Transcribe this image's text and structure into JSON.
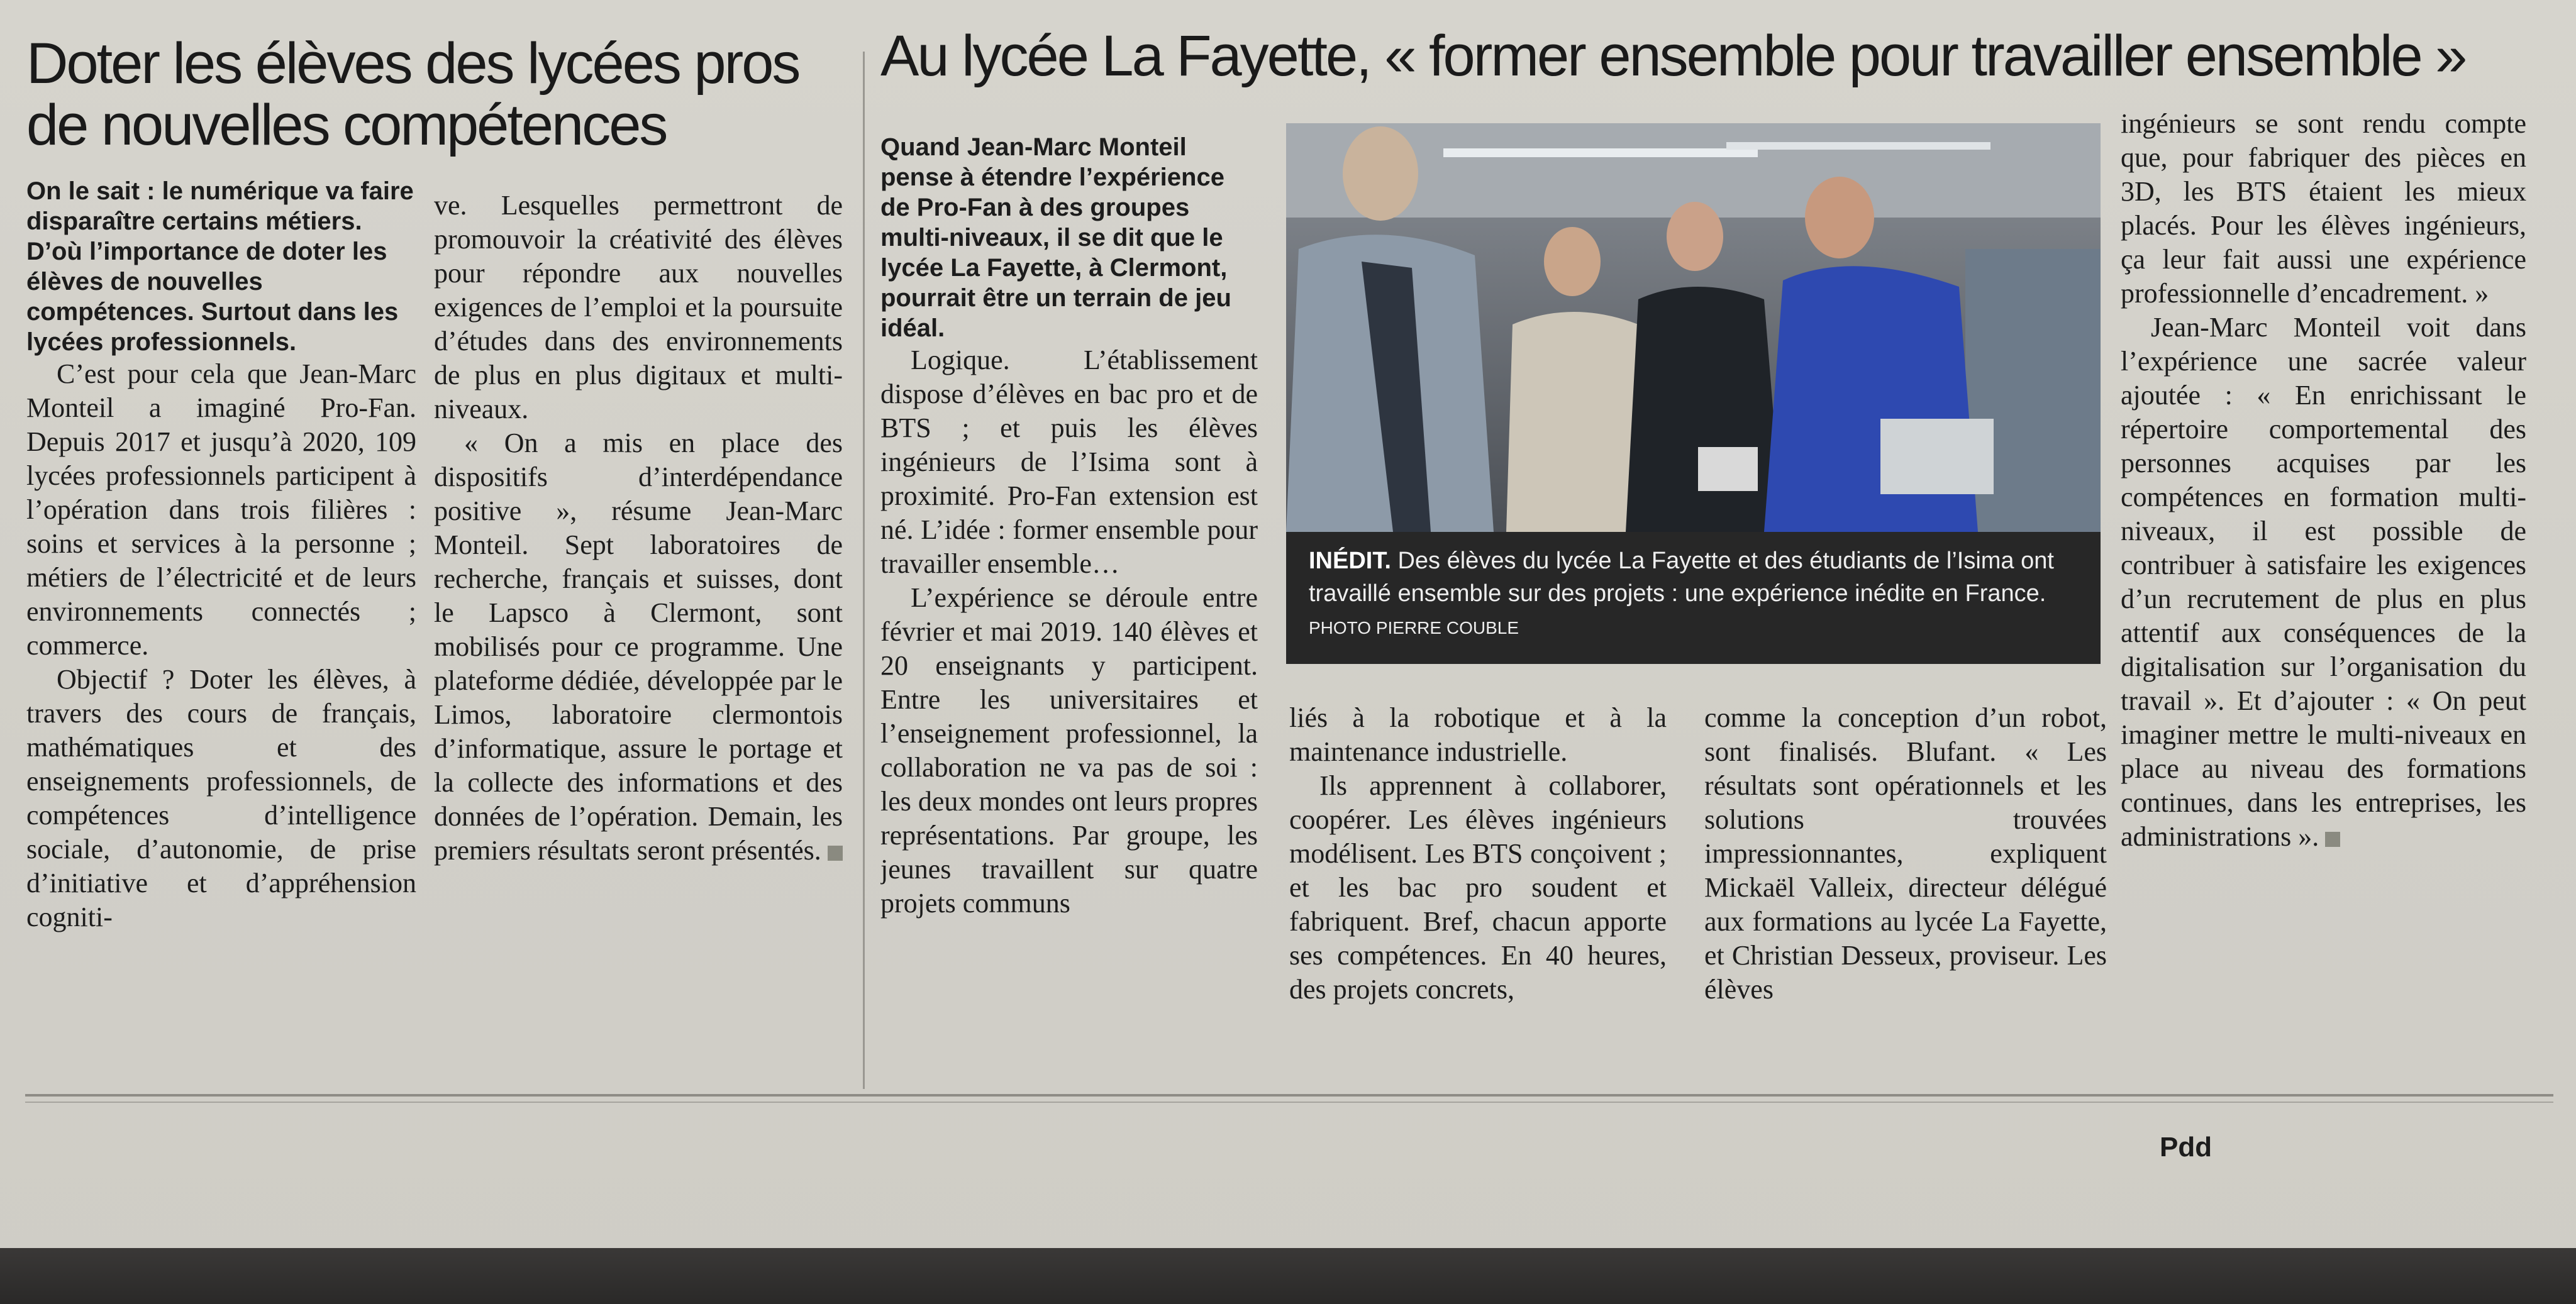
{
  "left_article": {
    "title_line1": "Doter les élèves des lycées pros",
    "title_line2": "de nouvelles compétences",
    "lead": "On le sait : le numérique va faire disparaître certains métiers. D’où l’importance de doter les élèves de nouvelles compétences. Surtout dans les lycées professionnels.",
    "col1_p1": "C’est pour cela que Jean-Marc Monteil a imaginé Pro-Fan. Depuis 2017 et jusqu’à 2020, 109 lycées professionnels participent à l’opération dans trois filières : soins et services à la personne ; métiers de l’électricité et de leurs environnements connectés ; commerce.",
    "col1_p2": "Objectif ? Doter les élèves, à travers des cours de français, mathématiques et des enseignements professionnels, de compétences d’intelligence sociale, d’autonomie, de prise d’initiative et d’appréhension cogniti-",
    "col2_p1": "ve. Lesquelles permettront de promouvoir la créativité des élèves pour répondre aux nouvelles exigences de l’emploi et la poursuite d’études dans des environnements de plus en plus digitaux et multi-niveaux.",
    "col2_p2": "« On a mis en place des dispositifs d’interdépendance positive », résume Jean-Marc Monteil. Sept laboratoires de recherche, français et suisses, dont le Lapsco à Clermont, sont mobilisés pour ce programme. Une plateforme dédiée, développée par le Limos, laboratoire clermontois d’informatique, assure le portage et la collecte des informations et des données de l’opération. Demain, les premiers résultats seront présentés."
  },
  "right_article": {
    "title": "Au lycée La Fayette, « former ensemble pour travailler ensemble »",
    "lead": "Quand Jean-Marc Monteil pense à étendre l’expérience de Pro-Fan à des groupes multi-niveaux, il se dit que le lycée La Fayette, à Clermont, pourrait être un terrain de jeu idéal.",
    "col3_p1": "Logique. L’établissement dispose d’élèves en bac pro et de BTS ; et puis les élèves ingénieurs de l’Isima sont à proximité. Pro-Fan extension est né. L’idée : former ensemble pour travailler ensemble…",
    "col3_p2": "L’expérience se déroule entre février et mai 2019. 140 élèves et 20 enseignants y participent. Entre les universitaires et l’enseignement professionnel, la collaboration ne va pas de soi : les deux mondes ont leurs propres représentations. Par groupe, les jeunes travaillent sur quatre projets communs",
    "col4_p1": "liés à la robotique et à la maintenance industrielle.",
    "col4_p2": "Ils apprennent à collaborer, coopérer. Les élèves ingénieurs modélisent. Les BTS conçoivent ; et les bac pro soudent et fabriquent. Bref, chacun apporte ses compétences. En 40 heures, des projets concrets,",
    "col5_p1": "comme la conception d’un robot, sont finalisés. Blufant. « Les résultats sont opérationnels et les solutions trouvées impressionnantes, expliquent Mickaël Valleix, directeur délégué aux formations au lycée La Fayette, et Christian Desseux, proviseur. Les élèves",
    "col6_p1": "ingénieurs se sont rendu compte que, pour fabriquer des pièces en 3D, les BTS étaient les mieux placés. Pour les élèves ingénieurs, ça leur fait aussi une expérience professionnelle d’encadrement. »",
    "col6_p2": "Jean-Marc Monteil voit dans l’expérience une sacrée valeur ajoutée : « En enrichissant le répertoire comportemental des personnes acquises par les compétences en formation multi-niveaux, il est possible de contribuer à satisfaire les exigences d’un recrutement de plus en plus attentif aux conséquences de la digitalisation sur l’organisation du travail ». Et d’ajouter : « On peut imaginer mettre le multi-niveaux en place au niveau des formations continues, dans les entreprises, les administrations ».",
    "caption_tag": "INÉDIT.",
    "caption_text": "Des élèves du lycée La Fayette et des étudiants de l’Isima ont travaillé ensemble sur des projets : une expérience inédite en France.",
    "caption_credit": "PHOTO PIERRE COUBLE"
  },
  "footer": {
    "signature": "Pdd"
  }
}
